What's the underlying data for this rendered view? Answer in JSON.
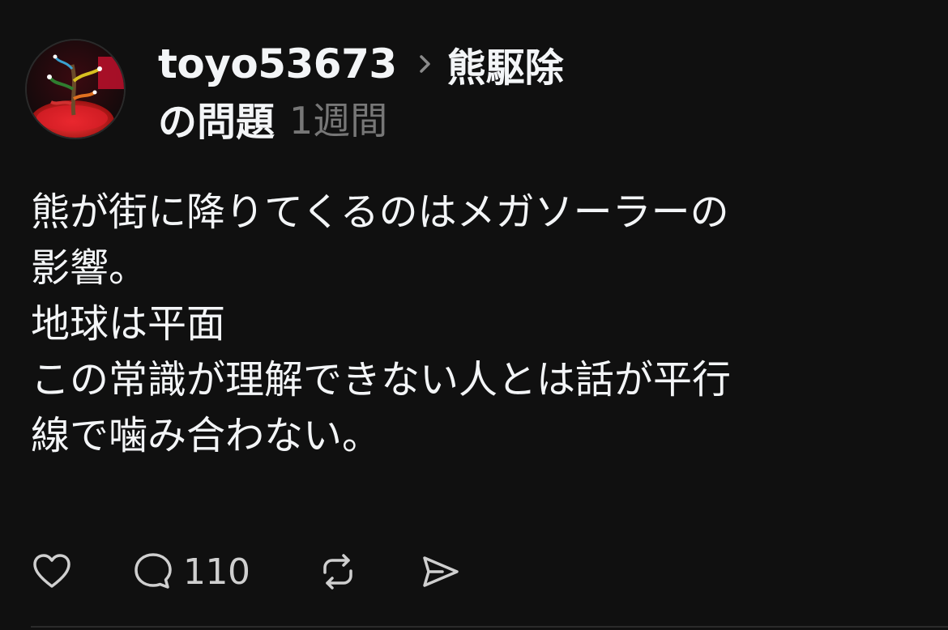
{
  "post": {
    "username": "toyo53673",
    "topic_part1": "熊駆除",
    "topic_part2": "の問題",
    "time": "1週間",
    "lines": [
      "熊が街に降りてくるのはメガソーラーの",
      "影響。",
      "地球は平面",
      "この常識が理解できない人とは話が平行",
      "線で噛み合わない。"
    ],
    "actions": {
      "like_icon": "heart-icon",
      "reply_icon": "comment-icon",
      "reply_count": "110",
      "repost_icon": "repost-icon",
      "share_icon": "send-icon"
    }
  },
  "colors": {
    "background": "#101010",
    "primary_text": "#f3f5f7",
    "secondary_text": "#777777"
  }
}
